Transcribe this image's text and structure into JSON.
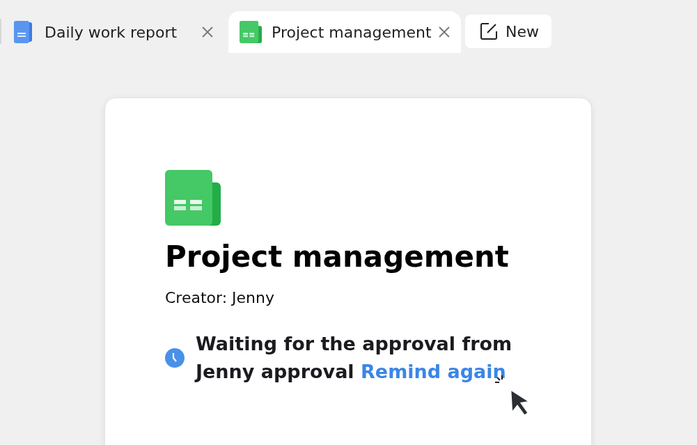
{
  "tabs": [
    {
      "kind": "doc",
      "label": "Daily work report",
      "selected": false
    },
    {
      "kind": "sheet",
      "label": "Project management",
      "selected": true
    }
  ],
  "new_button": {
    "label": "New"
  },
  "document": {
    "kind": "sheet",
    "title": "Project management",
    "creator": "Creator: Jenny",
    "status": {
      "message": "Waiting for the approval from Jenny approval",
      "link": "Remind again"
    }
  }
}
